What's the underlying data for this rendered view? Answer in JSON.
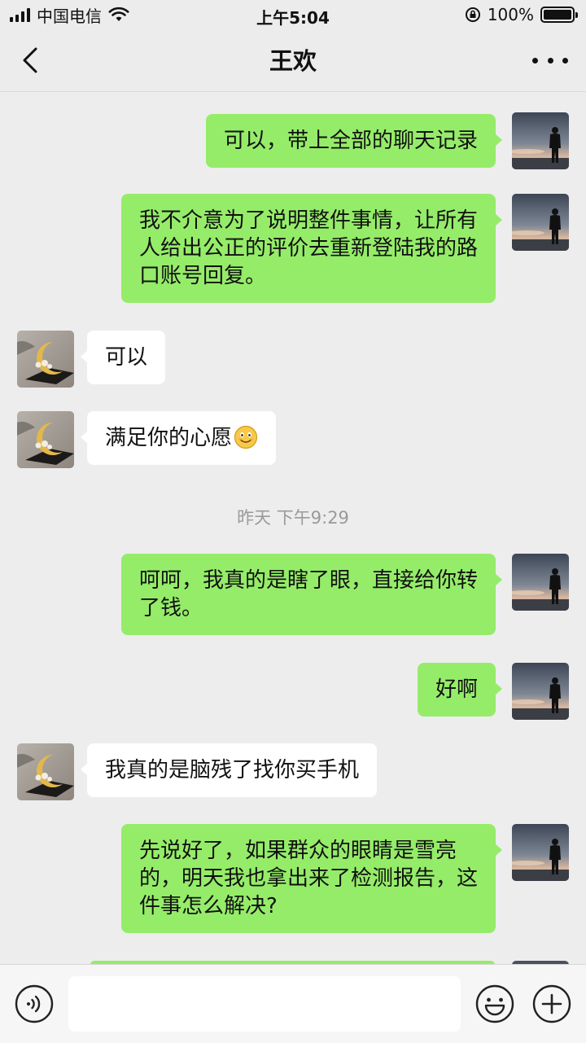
{
  "status_bar": {
    "carrier": "中国电信",
    "time": "上午5:04",
    "battery_percent": "100%",
    "battery_level": 1.0
  },
  "nav": {
    "title": "王欢"
  },
  "messages": [
    {
      "side": "me",
      "text": "可以，带上全部的聊天记录"
    },
    {
      "side": "me",
      "text": "我不介意为了说明整件事情，让所有\n人给出公正的评价去重新登陆我的路\n口账号回复。"
    },
    {
      "side": "them",
      "text": "可以"
    },
    {
      "side": "them",
      "text": "满足你的心愿",
      "emoji": "smile-emoji"
    },
    {
      "side": "me",
      "text": "呵呵，我真的是瞎了眼，直接给你转\n了钱。"
    },
    {
      "side": "me",
      "text": "好啊"
    },
    {
      "side": "them",
      "text": "我真的是脑残了找你买手机"
    },
    {
      "side": "me",
      "text": "先说好了，如果群众的眼睛是雪亮\n的，明天我也拿出来了检测报告，这\n件事怎么解决?"
    }
  ],
  "timestamp": "昨天 下午9:29",
  "input": {
    "value": "",
    "icons": [
      "voice-icon",
      "emoji-icon",
      "plus-icon"
    ]
  },
  "colors": {
    "my_bubble": "#95ec69",
    "their_bubble": "#ffffff",
    "background": "#ededed"
  }
}
